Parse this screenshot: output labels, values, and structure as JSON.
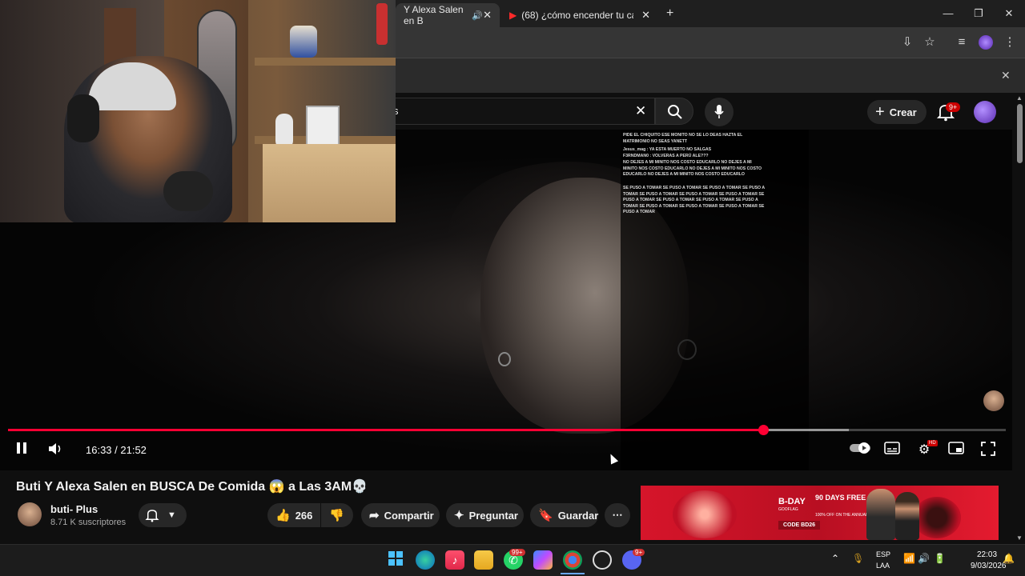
{
  "browser": {
    "tabs": [
      {
        "label": "Y Alexa Salen en B",
        "active": true
      },
      {
        "label": "(68) ¿cómo encender tu carro a",
        "active": false
      }
    ],
    "new_tab": "+",
    "close": "✕"
  },
  "youtube_header": {
    "search_fragment": "s",
    "create_label": "Crear",
    "notification_badge": "9+"
  },
  "stream_chat": [
    {
      "text": "PIDE EL CHIQUITO ESE MONITO NO SE LO DEAS HAZTA EL MATRIMONIO NO SEAS YANETT"
    },
    {
      "text": "Jesus_mag : YA ESTA MUERTO NO SALGAS"
    },
    {
      "text": "F3RNDMAN0 : VOLVERAS A PERÚ ALE???"
    },
    {
      "text": "NO DEJES A MI MINITO NOS COSTO EDUCARLO NO DEJES A MI MINITO NOS COSTO EDUCARLO NO DEJES A MI MINITO NOS COSTO EDUCARLO NO DEJES A MI MINITO NOS COSTO EDUCARLO"
    },
    {
      "text": "SE PUSO A TOMAR SE PUSO A TOMAR SE PUSO A TOMAR SE PUSO A TOMAR SE PUSO A TOMAR SE PUSO A TOMAR SE PUSO A TOMAR SE PUSO A TOMAR SE PUSO A TOMAR SE PUSO A TOMAR SE PUSO A TOMAR SE PUSO A TOMAR SE PUSO A TOMAR SE PUSO A TOMAR SE PUSO A TOMAR"
    }
  ],
  "player": {
    "current_time": "16:33",
    "duration": "21:52",
    "timecode": "16:33 / 21:52",
    "progress": 0.757,
    "buffered": 0.843
  },
  "video": {
    "title": "Buti Y Alexa Salen en BUSCA De Comida 😱 a Las 3AM💀",
    "channel_name": "buti- Plus",
    "subscribers": "8.71 K suscriptores",
    "likes": "266",
    "share_label": "Compartir",
    "ask_label": "Preguntar",
    "save_label": "Guardar",
    "more_label": "⋯"
  },
  "ad": {
    "brand": "B-DAY",
    "brand_sub": "GOOFLAG",
    "promo": "90 DAYS FREE",
    "promo_sub": "100% OFF ON THE ANNUAL PLAN",
    "code": "CODE BD26"
  },
  "taskbar": {
    "whatsapp_badge": "99+",
    "discord_badge": "9+",
    "lang_1": "ESP",
    "lang_2": "LAA",
    "time": "22:03",
    "date": "9/03/2026"
  },
  "colors": {
    "progress": "#ff0033",
    "background": "#0f0f0f",
    "badge": "#cc0000"
  }
}
